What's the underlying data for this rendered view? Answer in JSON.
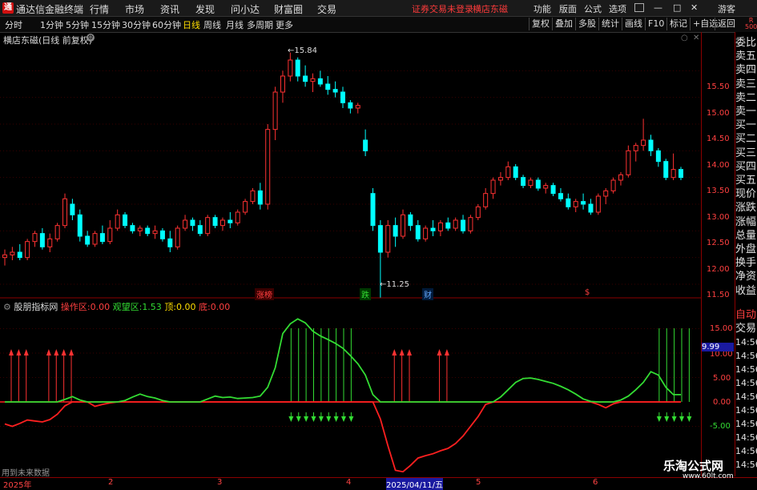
{
  "app": {
    "logo": "通",
    "title": "通达信金融终端",
    "menus": [
      "行情",
      "市场",
      "资讯",
      "发现",
      "问小达",
      "财富圈",
      "交易"
    ],
    "broker_notice": "证券交易未登录",
    "stock_name": "横店东磁",
    "top_right": [
      "功能",
      "版面",
      "公式",
      "选项"
    ],
    "window_controls": [
      "画线",
      "—",
      "□",
      "✕"
    ],
    "guest": "游客"
  },
  "periods": [
    "分时",
    "1分钟",
    "5分钟",
    "15分钟",
    "30分钟",
    "60分钟",
    "日线",
    "周线",
    "月线",
    "多周期",
    "更多"
  ],
  "active_period": "日线",
  "toolbar_right": [
    "复权",
    "叠加",
    "多股",
    "统计",
    "画线",
    "F10",
    "标记",
    "+自选",
    "返回"
  ],
  "main_chart": {
    "title": "横店东磁(日线 前复权)",
    "high_label": "15.84",
    "low_label": "11.25",
    "y_ticks": [
      "15.50",
      "15.00",
      "14.50",
      "14.00",
      "13.50",
      "13.00",
      "12.50",
      "12.00",
      "11.50"
    ],
    "markers": [
      "涨榜",
      "跌",
      "财",
      "$"
    ]
  },
  "indicator": {
    "name": "股朋指标网",
    "op_label": "操作区:",
    "op_value": "0.00",
    "watch_label": "观望区:",
    "watch_value": "1.53",
    "top_label": "顶:",
    "top_value": "0.00",
    "bottom_label": "底:",
    "bottom_value": "0.00",
    "y_ticks": [
      "15.00",
      "10.00",
      "5.00",
      "0.00",
      "-5.00"
    ],
    "current": "9.99",
    "footer": "用到未来数据"
  },
  "right_panel": {
    "top": [
      "R",
      "500"
    ],
    "items": [
      "委比",
      "卖五",
      "卖四",
      "卖三",
      "卖二",
      "卖一",
      "买一",
      "买二",
      "买三",
      "买四",
      "买五",
      "现价",
      "涨跌",
      "涨幅",
      "总量",
      "外盘",
      "换手",
      "净资",
      "收益"
    ],
    "auto": "自动",
    "trade": "交易",
    "times": [
      "14:56",
      "14:56",
      "14:56",
      "14:56",
      "14:56",
      "14:56",
      "14:56",
      "14:56",
      "14:56",
      "14:56"
    ]
  },
  "dates": [
    "2025年",
    "2",
    "3",
    "4",
    "2025/04/11/五",
    "5",
    "6"
  ],
  "watermark": {
    "title": "乐淘公式网",
    "url": "www.60lt.com"
  },
  "colors": {
    "up": "#ff3232",
    "down": "#00ffff",
    "indicator_line": "#33dd33",
    "zero_line": "#ff2020",
    "accent": "#ffde00"
  },
  "chart_data": {
    "type": "candlestick",
    "ylim": [
      11.2,
      16.0
    ],
    "candles": [
      [
        12.0,
        12.15,
        11.85,
        12.05
      ],
      [
        12.05,
        12.2,
        11.95,
        12.1
      ],
      [
        12.1,
        12.25,
        11.95,
        12.0
      ],
      [
        12.0,
        12.35,
        11.95,
        12.3
      ],
      [
        12.3,
        12.5,
        12.2,
        12.45
      ],
      [
        12.45,
        12.55,
        12.15,
        12.2
      ],
      [
        12.2,
        12.45,
        12.1,
        12.35
      ],
      [
        12.35,
        12.65,
        12.3,
        12.6
      ],
      [
        12.6,
        13.2,
        12.55,
        13.1
      ],
      [
        13.0,
        13.1,
        12.7,
        12.8
      ],
      [
        12.8,
        12.9,
        12.3,
        12.4
      ],
      [
        12.4,
        12.5,
        12.2,
        12.25
      ],
      [
        12.25,
        12.5,
        12.2,
        12.45
      ],
      [
        12.45,
        12.6,
        12.25,
        12.3
      ],
      [
        12.3,
        12.7,
        12.25,
        12.55
      ],
      [
        12.55,
        12.9,
        12.5,
        12.8
      ],
      [
        12.8,
        12.85,
        12.55,
        12.6
      ],
      [
        12.6,
        12.65,
        12.45,
        12.5
      ],
      [
        12.5,
        12.6,
        12.4,
        12.55
      ],
      [
        12.55,
        12.6,
        12.4,
        12.45
      ],
      [
        12.45,
        12.6,
        12.35,
        12.5
      ],
      [
        12.5,
        12.55,
        12.3,
        12.35
      ],
      [
        12.35,
        12.5,
        12.1,
        12.2
      ],
      [
        12.2,
        12.6,
        12.15,
        12.55
      ],
      [
        12.55,
        12.8,
        12.5,
        12.7
      ],
      [
        12.7,
        12.75,
        12.5,
        12.6
      ],
      [
        12.6,
        12.7,
        12.4,
        12.45
      ],
      [
        12.45,
        12.8,
        12.4,
        12.75
      ],
      [
        12.75,
        12.8,
        12.55,
        12.6
      ],
      [
        12.6,
        12.75,
        12.5,
        12.7
      ],
      [
        12.7,
        12.85,
        12.55,
        12.65
      ],
      [
        12.65,
        12.9,
        12.6,
        12.85
      ],
      [
        12.85,
        13.1,
        12.8,
        13.05
      ],
      [
        13.05,
        13.3,
        13.0,
        13.25
      ],
      [
        13.25,
        13.4,
        12.9,
        13.0
      ],
      [
        13.0,
        14.5,
        12.9,
        14.4
      ],
      [
        14.4,
        15.2,
        14.2,
        15.1
      ],
      [
        15.1,
        15.5,
        14.9,
        15.4
      ],
      [
        15.4,
        15.84,
        15.3,
        15.7
      ],
      [
        15.7,
        15.75,
        15.3,
        15.4
      ],
      [
        15.4,
        15.6,
        15.2,
        15.3
      ],
      [
        15.3,
        15.45,
        15.1,
        15.35
      ],
      [
        15.35,
        15.5,
        15.2,
        15.25
      ],
      [
        15.25,
        15.4,
        15.05,
        15.15
      ],
      [
        15.15,
        15.3,
        15.0,
        15.1
      ],
      [
        15.1,
        15.2,
        14.8,
        14.9
      ],
      [
        14.9,
        14.95,
        14.7,
        14.8
      ],
      [
        14.8,
        14.9,
        14.7,
        14.85
      ],
      [
        14.2,
        14.4,
        13.9,
        14.0
      ],
      [
        13.2,
        13.3,
        12.5,
        12.6
      ],
      [
        12.6,
        12.7,
        11.25,
        12.1
      ],
      [
        12.1,
        12.7,
        12.0,
        12.6
      ],
      [
        12.6,
        12.75,
        12.2,
        12.4
      ],
      [
        12.4,
        12.9,
        12.35,
        12.8
      ],
      [
        12.8,
        12.85,
        12.5,
        12.6
      ],
      [
        12.6,
        12.7,
        12.3,
        12.35
      ],
      [
        12.35,
        12.6,
        12.3,
        12.55
      ],
      [
        12.55,
        12.7,
        12.4,
        12.5
      ],
      [
        12.5,
        12.7,
        12.4,
        12.65
      ],
      [
        12.65,
        12.75,
        12.5,
        12.55
      ],
      [
        12.55,
        12.75,
        12.5,
        12.7
      ],
      [
        12.7,
        12.8,
        12.45,
        12.5
      ],
      [
        12.5,
        12.8,
        12.45,
        12.75
      ],
      [
        12.75,
        13.0,
        12.7,
        12.95
      ],
      [
        12.95,
        13.3,
        12.9,
        13.2
      ],
      [
        13.2,
        13.5,
        13.1,
        13.45
      ],
      [
        13.45,
        13.6,
        13.35,
        13.5
      ],
      [
        13.5,
        13.8,
        13.45,
        13.7
      ],
      [
        13.7,
        13.75,
        13.45,
        13.5
      ],
      [
        13.5,
        13.55,
        13.3,
        13.35
      ],
      [
        13.35,
        13.5,
        13.3,
        13.45
      ],
      [
        13.45,
        13.5,
        13.25,
        13.3
      ],
      [
        13.3,
        13.4,
        13.2,
        13.35
      ],
      [
        13.35,
        13.4,
        13.15,
        13.2
      ],
      [
        13.2,
        13.3,
        13.05,
        13.1
      ],
      [
        13.1,
        13.2,
        12.9,
        12.95
      ],
      [
        12.95,
        13.1,
        12.85,
        13.05
      ],
      [
        13.05,
        13.2,
        12.9,
        13.0
      ],
      [
        13.0,
        13.1,
        12.8,
        12.85
      ],
      [
        12.85,
        13.2,
        12.8,
        13.15
      ],
      [
        13.15,
        13.3,
        13.0,
        13.25
      ],
      [
        13.25,
        13.5,
        13.2,
        13.45
      ],
      [
        13.45,
        13.6,
        13.35,
        13.55
      ],
      [
        13.55,
        14.1,
        13.5,
        14.0
      ],
      [
        14.0,
        14.15,
        13.8,
        14.1
      ],
      [
        14.1,
        14.6,
        14.0,
        14.2
      ],
      [
        14.2,
        14.3,
        13.9,
        14.0
      ],
      [
        14.0,
        14.05,
        13.7,
        13.8
      ],
      [
        13.8,
        13.85,
        13.45,
        13.5
      ],
      [
        13.5,
        13.95,
        13.45,
        13.65
      ],
      [
        13.65,
        13.7,
        13.45,
        13.5
      ]
    ],
    "indicator_line": [
      0,
      0,
      0,
      0,
      0,
      0,
      0,
      0,
      0.5,
      1.1,
      0.4,
      0,
      0,
      0,
      0,
      0,
      0.3,
      1.0,
      1.6,
      1.1,
      0.8,
      0.3,
      0,
      0,
      0,
      0,
      0,
      0.6,
      1.2,
      0.9,
      1.0,
      0.7,
      0.8,
      0.9,
      1.2,
      3.0,
      7.0,
      14.0,
      16.0,
      17.0,
      16.2,
      14.5,
      13.5,
      12.8,
      12.0,
      11.0,
      9.5,
      7.8,
      5.5,
      1.5,
      0,
      0,
      0,
      0,
      0,
      0,
      0,
      0,
      0,
      0,
      0,
      0,
      0,
      0,
      0,
      0,
      1.0,
      2.5,
      4.0,
      4.8,
      4.9,
      4.6,
      4.2,
      3.8,
      3.2,
      2.5,
      1.6,
      0.6,
      0.1,
      0,
      0,
      0,
      0.4,
      1.2,
      2.5,
      4.0,
      6.2,
      5.5,
      3.0,
      1.5,
      1.5
    ],
    "zero_line_neg": [
      -4.5,
      -5.0,
      -4.4,
      -3.7,
      -3.9,
      -4.1,
      -3.6,
      -2.5,
      -0.8,
      0,
      0,
      0,
      -0.9,
      -0.5,
      -0.2,
      0,
      0,
      0,
      0,
      0,
      0,
      0,
      0,
      0,
      0,
      0,
      0,
      0,
      0,
      0,
      0,
      0,
      0,
      0,
      0,
      0,
      0,
      0,
      0,
      0,
      0,
      0,
      0,
      0,
      0,
      0,
      0,
      0,
      0,
      0,
      -3.5,
      -9.0,
      -14.0,
      -14.3,
      -13.0,
      -11.5,
      -11.0,
      -10.6,
      -10.0,
      -9.5,
      -8.5,
      -7.0,
      -5.0,
      -3.0,
      -0.5,
      0,
      0,
      0,
      0,
      0,
      0,
      0,
      0,
      0,
      0,
      0,
      0,
      0,
      0,
      -0.5,
      -1.2,
      -0.4,
      0,
      0,
      0,
      0,
      0,
      0,
      0,
      0,
      0
    ],
    "red_arrows": [
      0,
      1,
      2,
      5,
      6,
      7,
      8,
      51,
      52,
      53,
      57,
      58
    ],
    "green_arrows": [
      38,
      39,
      40,
      41,
      42,
      43,
      44,
      45,
      46,
      87,
      88,
      89,
      90,
      91
    ],
    "green_vlines": [
      38,
      39,
      40,
      41,
      42,
      43,
      44,
      45,
      46,
      87,
      88,
      89,
      90,
      91
    ]
  }
}
